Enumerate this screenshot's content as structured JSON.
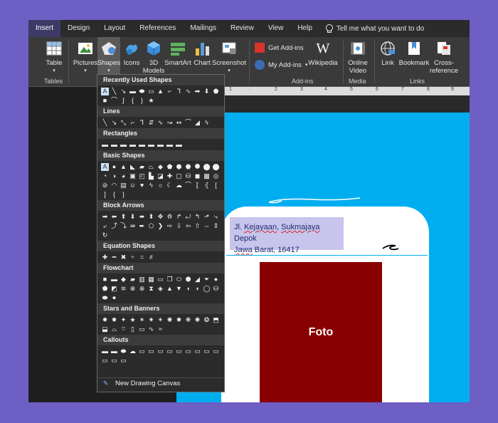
{
  "tabs": [
    "Insert",
    "Design",
    "Layout",
    "References",
    "Mailings",
    "Review",
    "View",
    "Help"
  ],
  "active_tab": "Insert",
  "tell_me": "Tell me what you want to do",
  "ribbon": {
    "table": "Table",
    "tables_group": "Tables",
    "pictures": "Pictures",
    "shapes": "Shapes",
    "icons": "Icons",
    "models_line1": "3D",
    "models_line2": "Models",
    "smartart": "SmartArt",
    "chart": "Chart",
    "screenshot": "Screenshot",
    "get_addins": "Get Add-ins",
    "my_addins": "My Add-ins",
    "wikipedia": "Wikipedia",
    "addins_group": "Add-ins",
    "online_line1": "Online",
    "online_line2": "Video",
    "media_group": "Media",
    "link": "Link",
    "bookmark": "Bookmark",
    "cross_line1": "Cross-",
    "cross_line2": "reference",
    "links_group": "Links"
  },
  "dropdown": {
    "sections": [
      {
        "title": "Recently Used Shapes"
      },
      {
        "title": "Lines"
      },
      {
        "title": "Rectangles"
      },
      {
        "title": "Basic Shapes"
      },
      {
        "title": "Block Arrows"
      },
      {
        "title": "Equation Shapes"
      },
      {
        "title": "Flowchart"
      },
      {
        "title": "Stars and Banners"
      },
      {
        "title": "Callouts"
      }
    ],
    "new_canvas": "New Drawing Canvas"
  },
  "document": {
    "address_line1_part1": "Jl. ",
    "address_line1_word1": "Kejayaan",
    "address_line1_comma": ", ",
    "address_line1_word2": "Sukmajaya",
    "address_line1_part2": " Depok",
    "address_line2_word": "Jawa",
    "address_line2_part": " Barat, 16417",
    "photo_label": "Foto"
  },
  "colors": {
    "background": "#6d5fc3",
    "doc_blue": "#00aeef",
    "photo": "#880000",
    "address_bg": "#c7c5ec"
  }
}
